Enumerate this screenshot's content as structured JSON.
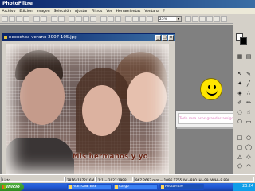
{
  "app": {
    "title": "PhotoFiltre"
  },
  "menu": [
    "Archivo",
    "Edición",
    "Imagen",
    "Selección",
    "Ajustar",
    "Filtros",
    "Ver",
    "Herramientas",
    "Ventana",
    "?"
  ],
  "toolbar": {
    "zoom_value": "25%"
  },
  "document": {
    "title": "necochea verano 2007 105.jpg",
    "caption": "Mis hermanos y yo"
  },
  "text_window": {
    "text": "Todo rosa esos grandes amigos..."
  },
  "palette": {
    "colors": [
      "#ffffff",
      "#000000"
    ]
  },
  "status": {
    "ready": "Listo",
    "size": "2816x1872/16M",
    "ratio": "1:1 = 2027:1998",
    "coords": "967,2667 mm = 1096,1765 (W=880, H=99, W/H=8,89)"
  },
  "taskbar": {
    "start_label": "Inicio",
    "tasks": [
      "ACETONE EXE",
      "Cargo",
      "PhotoFiltre"
    ],
    "clock": "23:24"
  }
}
